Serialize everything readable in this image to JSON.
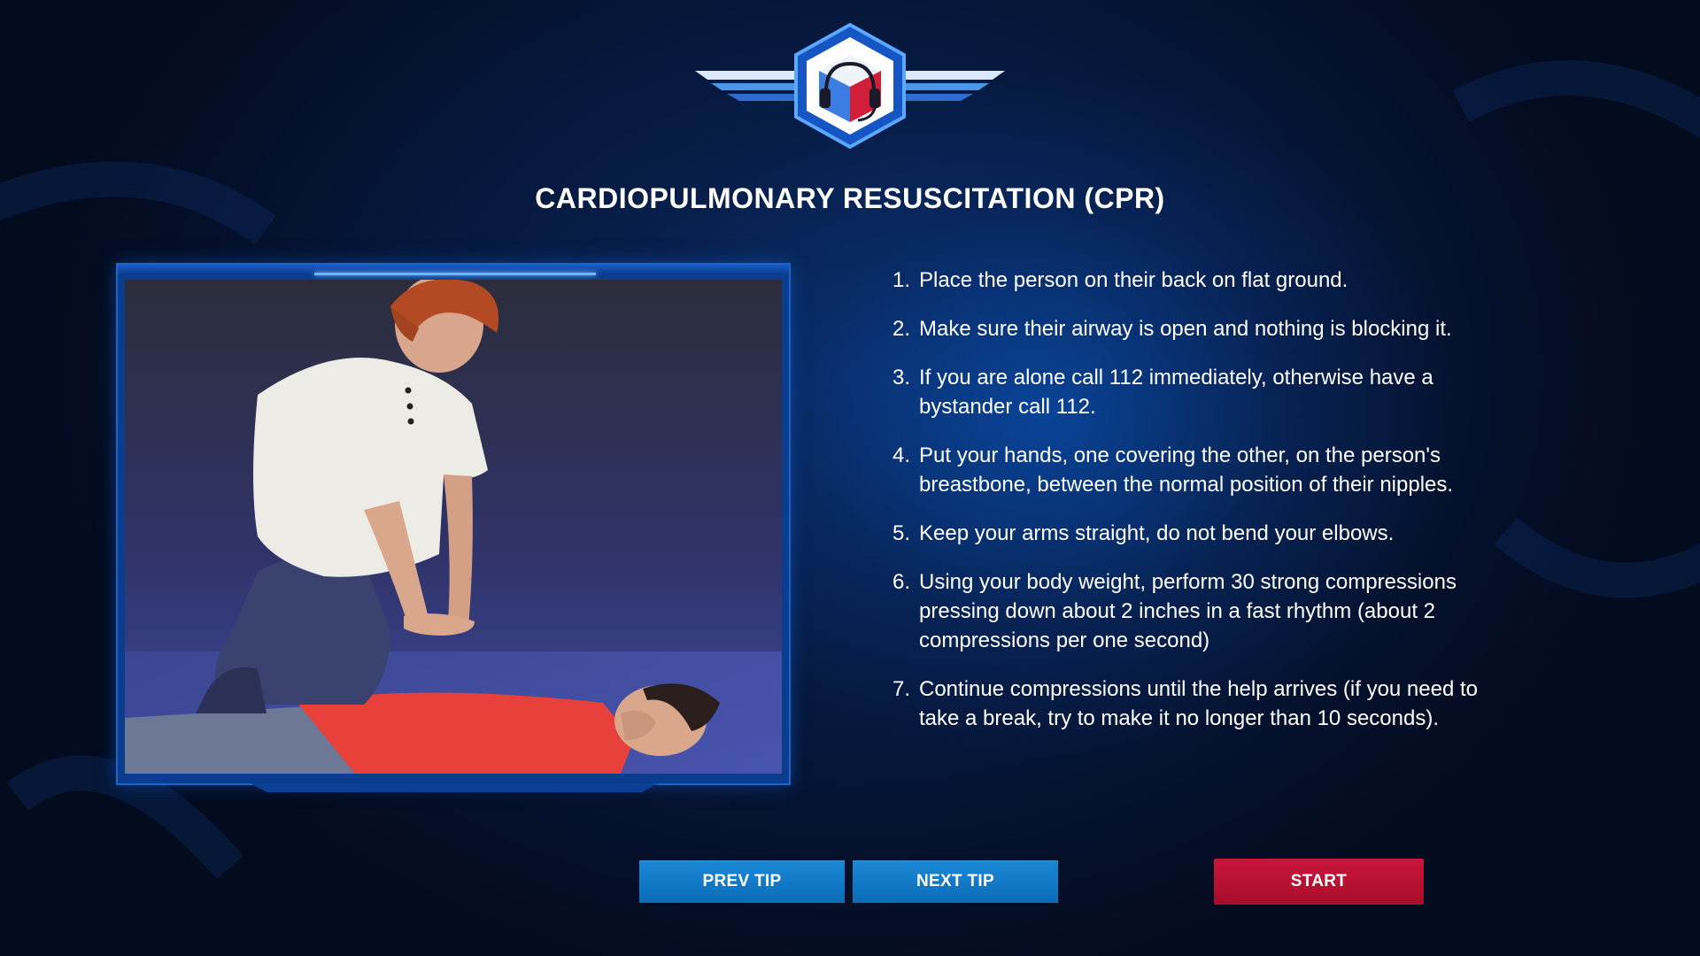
{
  "title": "CARDIOPULMONARY RESUSCITATION (CPR)",
  "logo_icon": "headset-cube-wings-logo",
  "illustration_icon": "cpr-chest-compression-illustration",
  "steps": [
    {
      "num": "1.",
      "text": "Place the person on their back on flat ground."
    },
    {
      "num": "2.",
      "text": "Make sure their airway is open and nothing is blocking it."
    },
    {
      "num": "3.",
      "text": "If you are alone call 112 immediately, otherwise have a bystander call 112."
    },
    {
      "num": "4.",
      "text": "Put your hands, one covering the other, on the person's breastbone, between the normal position of their nipples."
    },
    {
      "num": "5.",
      "text": "Keep your arms straight, do not bend your elbows."
    },
    {
      "num": "6.",
      "text": "Using your body weight, perform 30 strong compressions pressing down about 2 inches in a fast rhythm (about 2 compressions per one second)"
    },
    {
      "num": "7.",
      "text": "Continue compressions until the help arrives (if you need to take a break, try to make it no longer than 10 seconds)."
    }
  ],
  "buttons": {
    "prev": "PREV TIP",
    "next": "NEXT TIP",
    "start": "START"
  },
  "colors": {
    "accent_blue": "#0b6cb8",
    "start_red": "#b8102f",
    "frame_blue": "#0b3d8f"
  }
}
